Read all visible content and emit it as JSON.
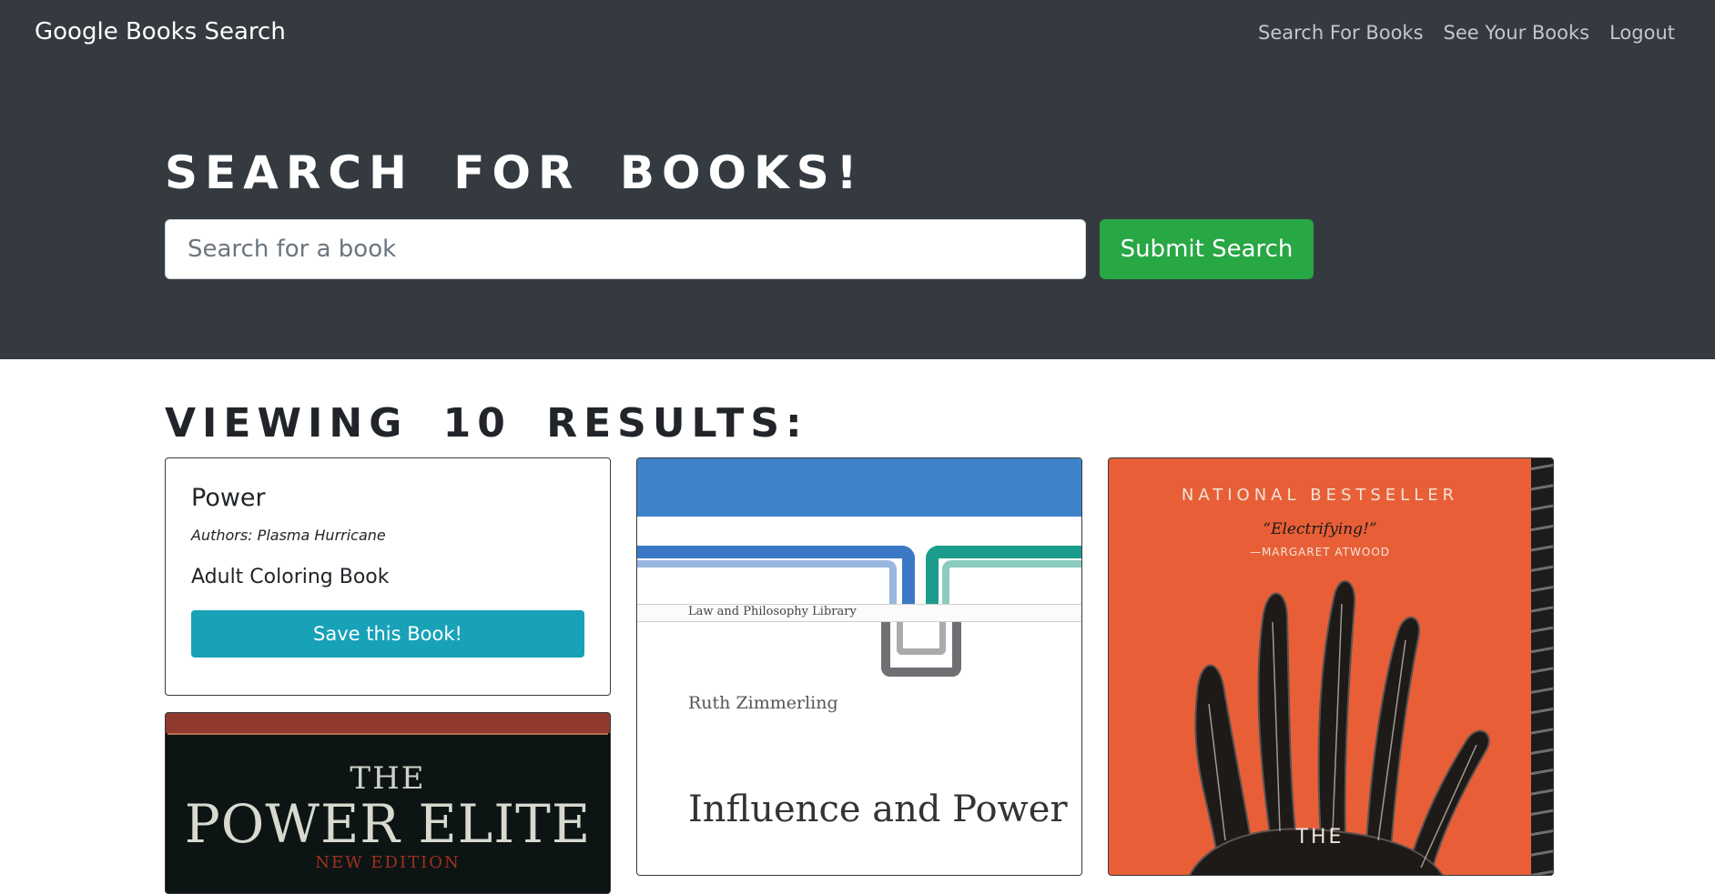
{
  "navbar": {
    "brand": "Google Books Search",
    "links": [
      "Search For Books",
      "See Your Books",
      "Logout"
    ]
  },
  "hero": {
    "title": "Search for Books!",
    "search_placeholder": "Search for a book",
    "submit_label": "Submit Search"
  },
  "results": {
    "heading": "Viewing 10 results:",
    "cards": [
      {
        "title": "Power",
        "authors": "Authors: Plasma Hurricane",
        "description": "Adult Coloring Book",
        "save_label": "Save this Book!"
      },
      {
        "cover_texts": [
          "THE",
          "POWER ELITE",
          "NEW EDITION"
        ]
      },
      {
        "cover_texts": [
          "Law and Philosophy Library",
          "Ruth Zimmerling",
          "Influence and Power"
        ],
        "colors": {
          "band": "#3e83c9",
          "frame_blue": "#3b79c6",
          "frame_green": "#1c9c8c"
        }
      },
      {
        "cover_texts": [
          "NATIONAL BESTSELLER",
          "“Electrifying!”",
          "—MARGARET ATWOOD",
          "THE"
        ],
        "colors": {
          "background": "#e85f37"
        }
      }
    ]
  },
  "colors": {
    "header_bg": "#343a40",
    "submit_green": "#28a745",
    "save_teal": "#17a2b8"
  }
}
